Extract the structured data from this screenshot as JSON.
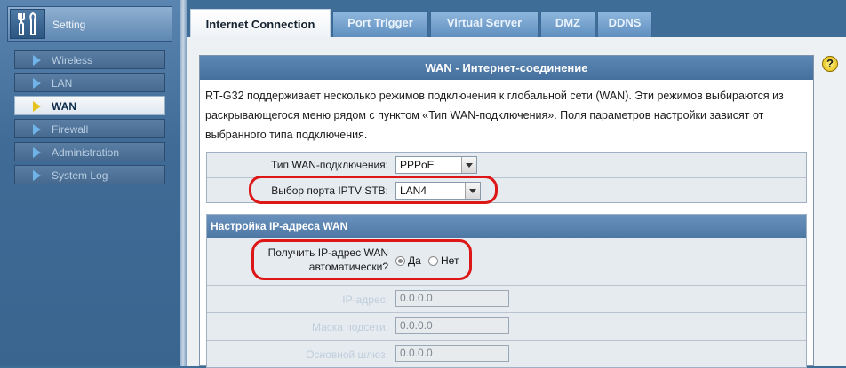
{
  "sidebar": {
    "header_label": "Setting",
    "items": [
      {
        "label": "Wireless",
        "active": false
      },
      {
        "label": "LAN",
        "active": false
      },
      {
        "label": "WAN",
        "active": true
      },
      {
        "label": "Firewall",
        "active": false
      },
      {
        "label": "Administration",
        "active": false
      },
      {
        "label": "System Log",
        "active": false
      }
    ]
  },
  "tabs": [
    {
      "label": "Internet Connection",
      "active": true
    },
    {
      "label": "Port Trigger",
      "active": false
    },
    {
      "label": "Virtual Server",
      "active": false
    },
    {
      "label": "DMZ",
      "active": false
    },
    {
      "label": "DDNS",
      "active": false
    }
  ],
  "help": {
    "glyph": "?"
  },
  "panel": {
    "title": "WAN - Интернет-соединение",
    "description": "RT-G32 поддерживает несколько режимов подключения к глобальной сети (WAN). Эти режимов выбираются из раскрывающегося меню рядом с пунктом «Тип WAN-подключения». Поля параметров настройки зависят от выбранного типа подключения.",
    "wan_type": {
      "label": "Тип WAN-подключения:",
      "value": "PPPoE"
    },
    "iptv_port": {
      "label": "Выбор порта IPTV STB:",
      "value": "LAN4"
    }
  },
  "ip_section": {
    "title": "Настройка IP-адреса WAN",
    "auto_ip": {
      "label": "Получить IP-адрес WAN автоматически?",
      "yes": "Да",
      "no": "Нет",
      "selected": "yes"
    },
    "ip_address": {
      "label": "IP-адрес:",
      "value": "0.0.0.0"
    },
    "subnet_mask": {
      "label": "Маска подсети:",
      "value": "0.0.0.0"
    },
    "gateway": {
      "label": "Основной шлюз:",
      "value": "0.0.0.0"
    }
  },
  "colors": {
    "highlight": "#dd1717",
    "panel_header": "#4f79a6",
    "sidebar_bg": "#3e6d98"
  }
}
